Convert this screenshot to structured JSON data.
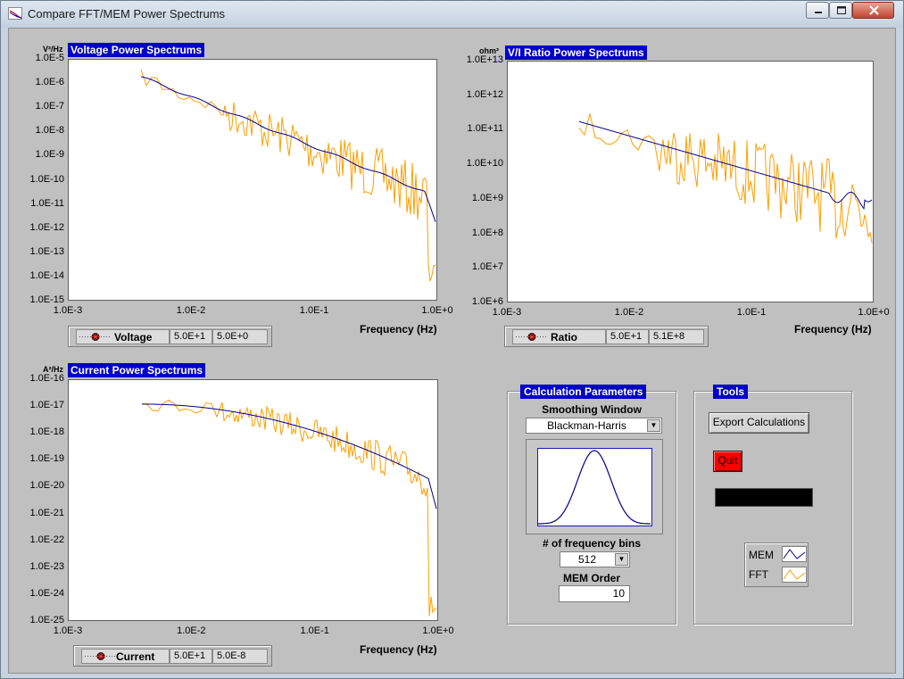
{
  "window": {
    "title": "Compare FFT/MEM Power Spectrums"
  },
  "colors": {
    "mem": "#00008b",
    "fft": "#ff9e00",
    "title_bg": "#0000c8",
    "quit": "#ff0000"
  },
  "graphs": [
    {
      "id": "voltage",
      "title": "Voltage Power Spectrums",
      "yunit": "V²/Hz",
      "y_ticks": [
        "1.0E-5",
        "1.0E-6",
        "1.0E-7",
        "1.0E-8",
        "1.0E-9",
        "1.0E-10",
        "1.0E-11",
        "1.0E-12",
        "1.0E-13",
        "1.0E-14",
        "1.0E-15"
      ],
      "x_ticks": [
        "1.0E-3",
        "1.0E-2",
        "1.0E-1",
        "1.0E+0"
      ],
      "xlabel": "Frequency (Hz)",
      "legend": {
        "name": "Voltage",
        "v1": "5.0E+1",
        "v2": "5.0E+0"
      }
    },
    {
      "id": "ratio",
      "title": "V/I Ratio Power Spectrums",
      "yunit": "ohm²",
      "y_ticks": [
        "1.0E+13",
        "1.0E+12",
        "1.0E+11",
        "1.0E+10",
        "1.0E+9",
        "1.0E+8",
        "1.0E+7",
        "1.0E+6"
      ],
      "x_ticks": [
        "1.0E-3",
        "1.0E-2",
        "1.0E-1",
        "1.0E+0"
      ],
      "xlabel": "Frequency (Hz)",
      "legend": {
        "name": "Ratio",
        "v1": "5.0E+1",
        "v2": "5.1E+8"
      }
    },
    {
      "id": "current",
      "title": "Current Power Spectrums",
      "yunit": "A²/Hz",
      "y_ticks": [
        "1.0E-16",
        "1.0E-17",
        "1.0E-18",
        "1.0E-19",
        "1.0E-20",
        "1.0E-21",
        "1.0E-22",
        "1.0E-23",
        "1.0E-24",
        "1.0E-25"
      ],
      "x_ticks": [
        "1.0E-3",
        "1.0E-2",
        "1.0E-1",
        "1.0E+0"
      ],
      "xlabel": "Frequency (Hz)",
      "legend": {
        "name": "Current",
        "v1": "5.0E+1",
        "v2": "5.0E-8"
      }
    }
  ],
  "calc": {
    "title": "Calculation Parameters",
    "smoothing_label": "Smoothing Window",
    "smoothing_value": "Blackman-Harris",
    "bins_label": "# of frequency bins",
    "bins_value": "512",
    "mem_label": "MEM Order",
    "mem_value": "10"
  },
  "tools": {
    "title": "Tools",
    "export_label": "Export Calculations",
    "quit_label": "Quit",
    "legend": [
      {
        "name": "MEM"
      },
      {
        "name": "FFT"
      }
    ]
  }
}
